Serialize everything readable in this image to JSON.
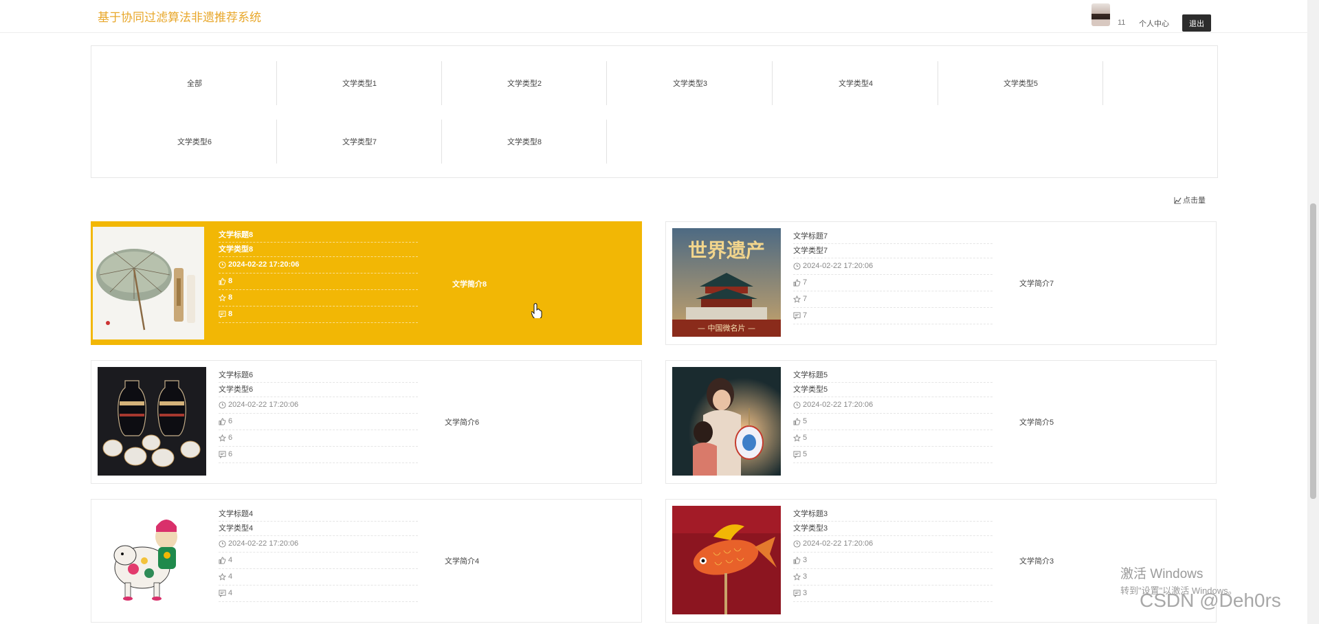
{
  "header": {
    "title": "基于协同过滤算法非遗推荐系统",
    "username": "11",
    "user_center_label": "个人中心",
    "logout_label": "退出"
  },
  "categories": [
    "全部",
    "文学类型1",
    "文学类型2",
    "文学类型3",
    "文学类型4",
    "文学类型5",
    "文学类型6",
    "文学类型7",
    "文学类型8"
  ],
  "sort_label": "点击量",
  "cards": [
    {
      "title": "文学标题8",
      "type": "文学类型8",
      "date": "2024-02-22 17:20:06",
      "likes": "8",
      "favorites": "8",
      "comments": "8",
      "intro": "文学简介8",
      "active": true
    },
    {
      "title": "文学标题7",
      "type": "文学类型7",
      "date": "2024-02-22 17:20:06",
      "likes": "7",
      "favorites": "7",
      "comments": "7",
      "intro": "文学简介7",
      "active": false
    },
    {
      "title": "文学标题6",
      "type": "文学类型6",
      "date": "2024-02-22 17:20:06",
      "likes": "6",
      "favorites": "6",
      "comments": "6",
      "intro": "文学简介6",
      "active": false
    },
    {
      "title": "文学标题5",
      "type": "文学类型5",
      "date": "2024-02-22 17:20:06",
      "likes": "5",
      "favorites": "5",
      "comments": "5",
      "intro": "文学简介5",
      "active": false
    },
    {
      "title": "文学标题4",
      "type": "文学类型4",
      "date": "2024-02-22 17:20:06",
      "likes": "4",
      "favorites": "4",
      "comments": "4",
      "intro": "文学简介4",
      "active": false
    },
    {
      "title": "文学标题3",
      "type": "文学类型3",
      "date": "2024-02-22 17:20:06",
      "likes": "3",
      "favorites": "3",
      "comments": "3",
      "intro": "文学简介3",
      "active": false
    }
  ],
  "image_text": {
    "card_7_title": "世界遗产",
    "card_7_subtitle": "— 中国微名片 —"
  },
  "watermark": {
    "activate_line1": "激活 Windows",
    "activate_line2": "转到\"设置\"以激活 Windows。",
    "csdn": "CSDN @Deh0rs"
  },
  "colors": {
    "brand": "#e8a72a",
    "active_card": "#f2b705",
    "logout_bg": "#2c2c2c"
  }
}
